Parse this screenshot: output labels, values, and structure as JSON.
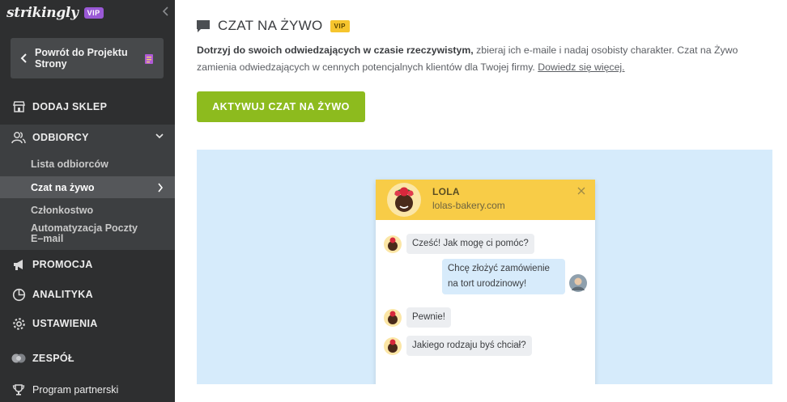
{
  "sidebar": {
    "brand": "strikingly",
    "brand_badge": "VIP",
    "back_label": "Powrót do Projektu Strony",
    "nav": {
      "add_store": "DODAJ SKLEP",
      "audience": "ODBIORCY",
      "promotion": "PROMOCJA",
      "analytics": "ANALITYKA",
      "settings": "USTAWIENIA",
      "team": "ZESPÓŁ",
      "partner": "Program partnerski"
    },
    "sub_items": {
      "audience_list": "Lista odbiorców",
      "live_chat": "Czat na żywo",
      "membership": "Członkostwo",
      "email_automation": "Automatyzacja Poczty E–mail"
    }
  },
  "main": {
    "title": "CZAT NA ŻYWO",
    "title_badge": "VIP",
    "desc_bold": "Dotrzyj do swoich odwiedzających w czasie rzeczywistym,",
    "desc_rest": " zbieraj ich e-maile i nadaj osobisty charakter. Czat na Żywo zamienia odwiedzających w cennych potencjalnych klientów dla Twojej firmy.",
    "learn_more": "Dowiedz się więcej.",
    "cta_label": "AKTYWUJ CZAT NA ŻYWO"
  },
  "chat_preview": {
    "agent_name": "LOLA",
    "agent_site": "lolas-bakery.com",
    "messages": [
      {
        "from": "agent",
        "text": "Cześć! Jak mogę ci pomóc?"
      },
      {
        "from": "visitor",
        "text": "Chcę złożyć zamówienie na tort urodzinowy!"
      },
      {
        "from": "agent",
        "text": "Pewnie!"
      },
      {
        "from": "agent",
        "text": "Jakiego rodzaju byś chciał?"
      }
    ]
  },
  "colors": {
    "sidebar_bg": "#2e2f30",
    "cta_green": "#8dbb1e",
    "vip_purple": "#9a59d6",
    "vip_yellow": "#f6c52e",
    "chat_header": "#f8cc47",
    "preview_bg": "#d6ebfb"
  },
  "icons": {
    "collapse": "chevron-left-icon",
    "back": "chevron-left-icon",
    "page": "page-icon",
    "store": "store-icon",
    "audience": "users-icon",
    "promotion": "megaphone-icon",
    "analytics": "pie-chart-icon",
    "settings": "gear-icon",
    "team": "team-icon",
    "partner": "trophy-icon",
    "chat": "chat-bubble-icon",
    "close": "close-icon"
  }
}
